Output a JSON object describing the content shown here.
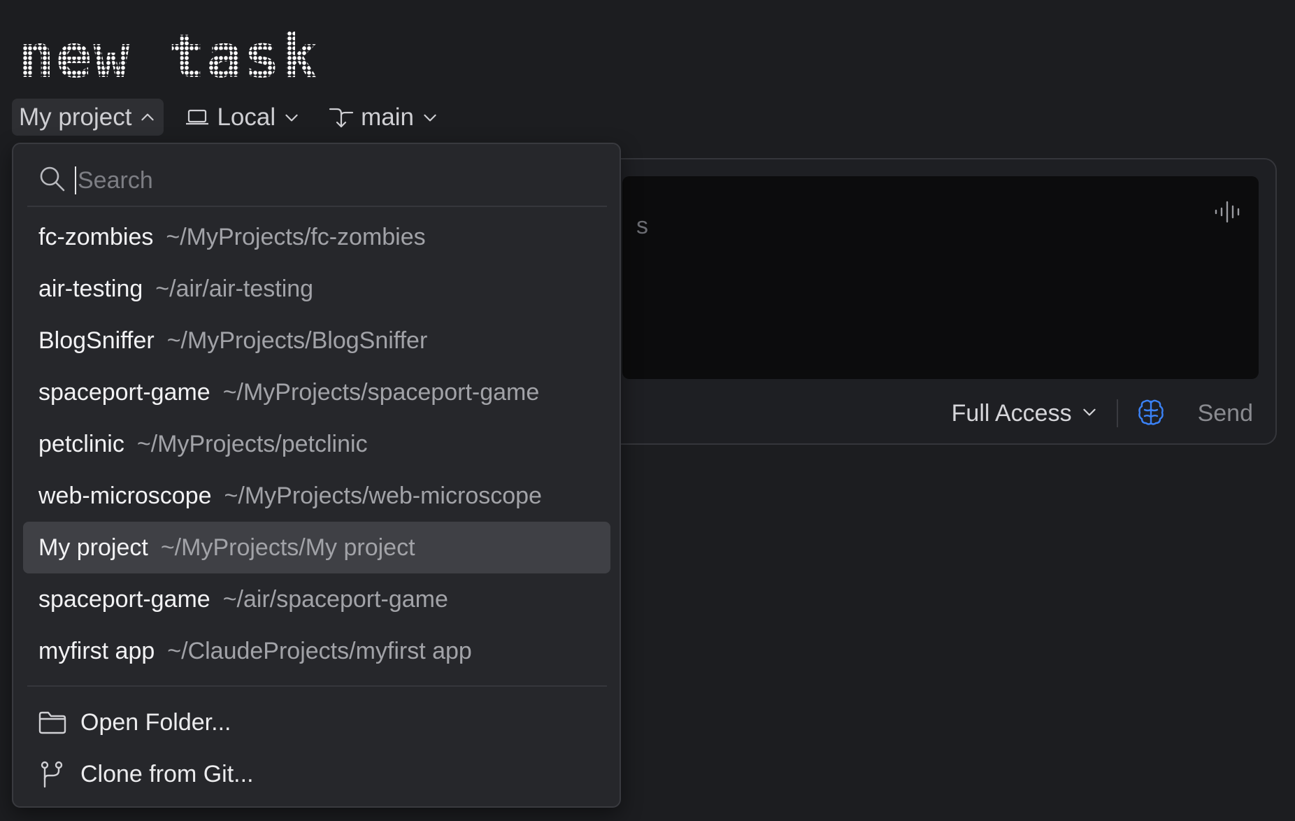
{
  "title": "new task",
  "toolbar": {
    "project_label": "My project",
    "env_label": "Local",
    "branch_label": "main"
  },
  "composer": {
    "placeholder_visible": "s",
    "access_label": "Full Access",
    "send_label": "Send"
  },
  "dropdown": {
    "search_placeholder": "Search",
    "projects": [
      {
        "name": "fc-zombies",
        "path": "~/MyProjects/fc-zombies",
        "selected": false
      },
      {
        "name": "air-testing",
        "path": "~/air/air-testing",
        "selected": false
      },
      {
        "name": "BlogSniffer",
        "path": "~/MyProjects/BlogSniffer",
        "selected": false
      },
      {
        "name": "spaceport-game",
        "path": "~/MyProjects/spaceport-game",
        "selected": false
      },
      {
        "name": "petclinic",
        "path": "~/MyProjects/petclinic",
        "selected": false
      },
      {
        "name": "web-microscope",
        "path": "~/MyProjects/web-microscope",
        "selected": false
      },
      {
        "name": "My project",
        "path": "~/MyProjects/My project",
        "selected": true
      },
      {
        "name": "spaceport-game",
        "path": "~/air/spaceport-game",
        "selected": false
      },
      {
        "name": "myfirst app",
        "path": "~/ClaudeProjects/myfirst app",
        "selected": false
      }
    ],
    "open_folder_label": "Open Folder...",
    "clone_label": "Clone from Git..."
  },
  "colors": {
    "background": "#1c1d20",
    "dropdown_bg": "#26272b",
    "selected_bg": "#3f4045",
    "accent_blue": "#3b82f6"
  },
  "icons": [
    "chevron-up-icon",
    "laptop-icon",
    "branch-icon",
    "chevron-down-icon",
    "search-icon",
    "mic-waveform-icon",
    "brain-icon",
    "folder-icon",
    "git-fork-icon"
  ]
}
